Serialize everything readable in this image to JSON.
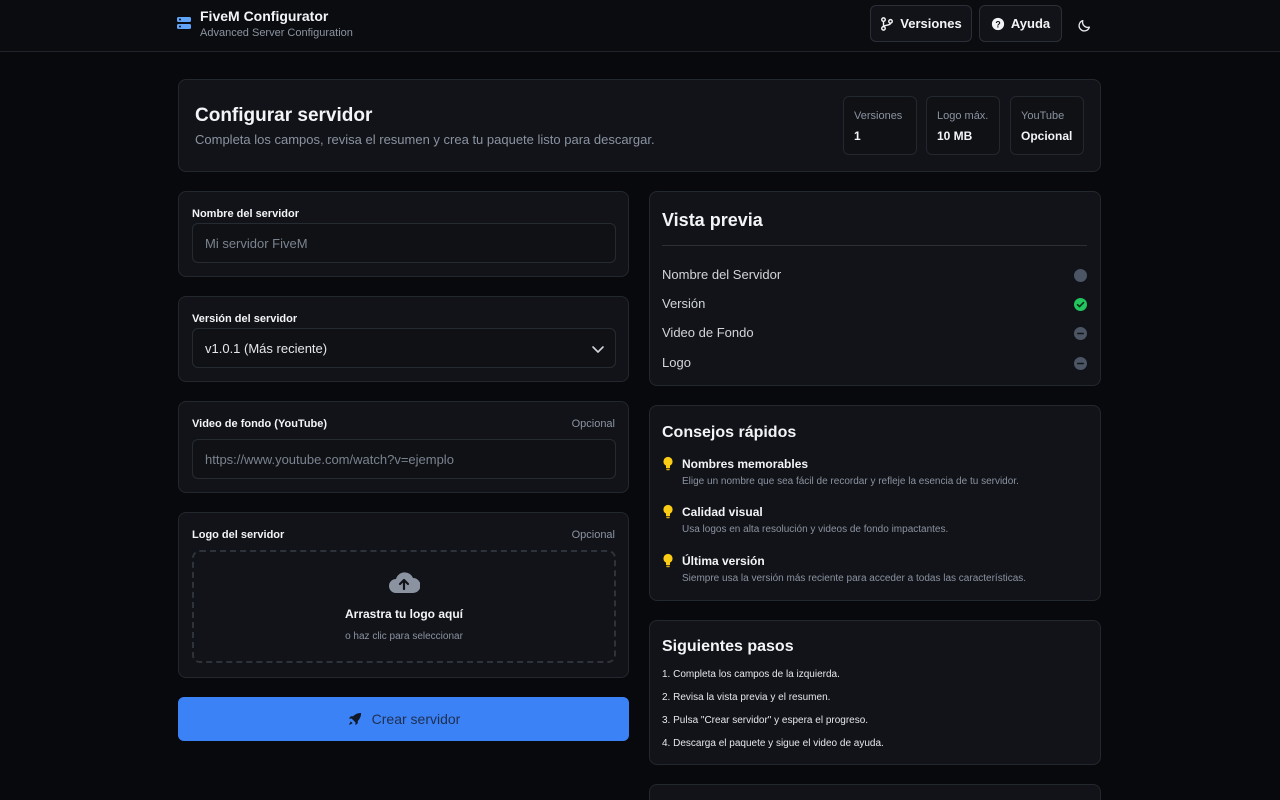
{
  "header": {
    "title": "FiveM Configurator",
    "subtitle": "Advanced Server Configuration",
    "versions_label": "Versiones",
    "help_label": "Ayuda"
  },
  "intro": {
    "title": "Configurar servidor",
    "subtitle": "Completa los campos, revisa el resumen y crea tu paquete listo para descargar.",
    "stats": [
      {
        "label": "Versiones",
        "value": "1"
      },
      {
        "label": "Logo máx.",
        "value": "10 MB"
      },
      {
        "label": "YouTube",
        "value": "Opcional"
      }
    ]
  },
  "form": {
    "name": {
      "label": "Nombre del servidor",
      "placeholder": "Mi servidor FiveM"
    },
    "version": {
      "label": "Versión del servidor",
      "value": "v1.0.1 (Más reciente)"
    },
    "video": {
      "label": "Video de fondo (YouTube)",
      "optional": "Opcional",
      "placeholder": "https://www.youtube.com/watch?v=ejemplo"
    },
    "logo": {
      "label": "Logo del servidor",
      "optional": "Opcional",
      "drop_title": "Arrastra tu logo aquí",
      "drop_sub": "o haz clic para seleccionar"
    },
    "submit_label": "Crear servidor"
  },
  "preview": {
    "title": "Vista previa",
    "rows": [
      {
        "label": "Nombre del Servidor",
        "status": "pending"
      },
      {
        "label": "Versión",
        "status": "ok"
      },
      {
        "label": "Video de Fondo",
        "status": "none"
      },
      {
        "label": "Logo",
        "status": "none"
      }
    ]
  },
  "tips": {
    "title": "Consejos rápidos",
    "items": [
      {
        "title": "Nombres memorables",
        "desc": "Elige un nombre que sea fácil de recordar y refleje la esencia de tu servidor."
      },
      {
        "title": "Calidad visual",
        "desc": "Usa logos en alta resolución y videos de fondo impactantes."
      },
      {
        "title": "Última versión",
        "desc": "Siempre usa la versión más reciente para acceder a todas las características."
      }
    ]
  },
  "steps": {
    "title": "Siguientes pasos",
    "items": [
      "1. Completa los campos de la izquierda.",
      "2. Revisa la vista previa y el resumen.",
      "3. Pulsa \"Crear servidor\" y espera el progreso.",
      "4. Descarga el paquete y sigue el video de ayuda."
    ]
  },
  "colors": {
    "accent": "#3b82f6",
    "background": "#08090c",
    "card": "#111318",
    "success": "#22c55e",
    "bulb": "#facc15"
  }
}
